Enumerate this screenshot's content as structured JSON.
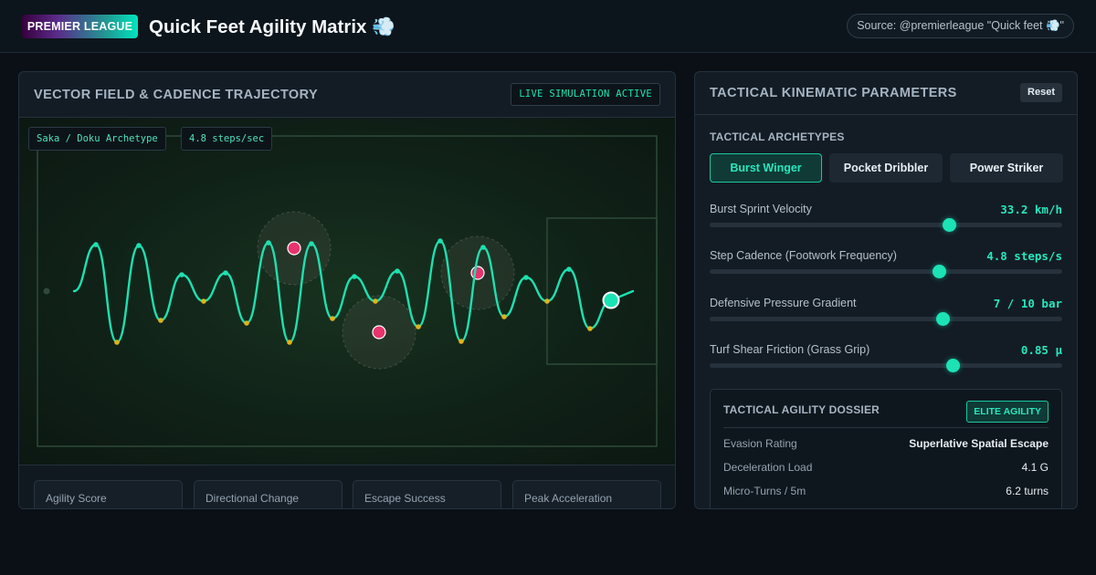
{
  "header": {
    "brand": "PREMIER LEAGUE",
    "title": "Quick Feet Agility Matrix 💨",
    "source": "Source: @premierleague \"Quick feet 💨\""
  },
  "visualization": {
    "title": "VECTOR FIELD & CADENCE TRAJECTORY",
    "status_badge": "LIVE SIMULATION ACTIVE",
    "archetype_chip": "Saka / Doku Archetype",
    "cadence_chip": "4.8 steps/sec",
    "colors": {
      "trajectory": "#1de0b0",
      "foot_strike": "#e0b21a",
      "defender": "#e8336e",
      "player": "#1be3b6"
    }
  },
  "kpi_cards": [
    {
      "label": "Agility Score"
    },
    {
      "label": "Directional Change"
    },
    {
      "label": "Escape Success"
    },
    {
      "label": "Peak Acceleration"
    }
  ],
  "parameters_panel": {
    "title": "TACTICAL KINEMATIC PARAMETERS",
    "reset_label": "Reset",
    "archetypes_label": "TACTICAL ARCHETYPES",
    "archetypes": [
      {
        "label": "Burst Winger",
        "active": true
      },
      {
        "label": "Pocket Dribbler",
        "active": false
      },
      {
        "label": "Power Striker",
        "active": false
      }
    ],
    "sliders": [
      {
        "label": "Burst Sprint Velocity",
        "value": "33.2 km/h",
        "fill": 0.68
      },
      {
        "label": "Step Cadence (Footwork Frequency)",
        "value": "4.8 steps/s",
        "fill": 0.65
      },
      {
        "label": "Defensive Pressure Gradient",
        "value": "7 / 10 bar",
        "fill": 0.66
      },
      {
        "label": "Turf Shear Friction (Grass Grip)",
        "value": "0.85 μ",
        "fill": 0.69
      }
    ],
    "dossier": {
      "title": "TACTICAL AGILITY DOSSIER",
      "badge": "ELITE AGILITY",
      "rows": [
        {
          "label": "Evasion Rating",
          "value": "Superlative Spatial Escape"
        },
        {
          "label": "Deceleration Load",
          "value": "4.1 G"
        },
        {
          "label": "Micro-Turns / 5m",
          "value": "6.2 turns"
        }
      ]
    }
  }
}
